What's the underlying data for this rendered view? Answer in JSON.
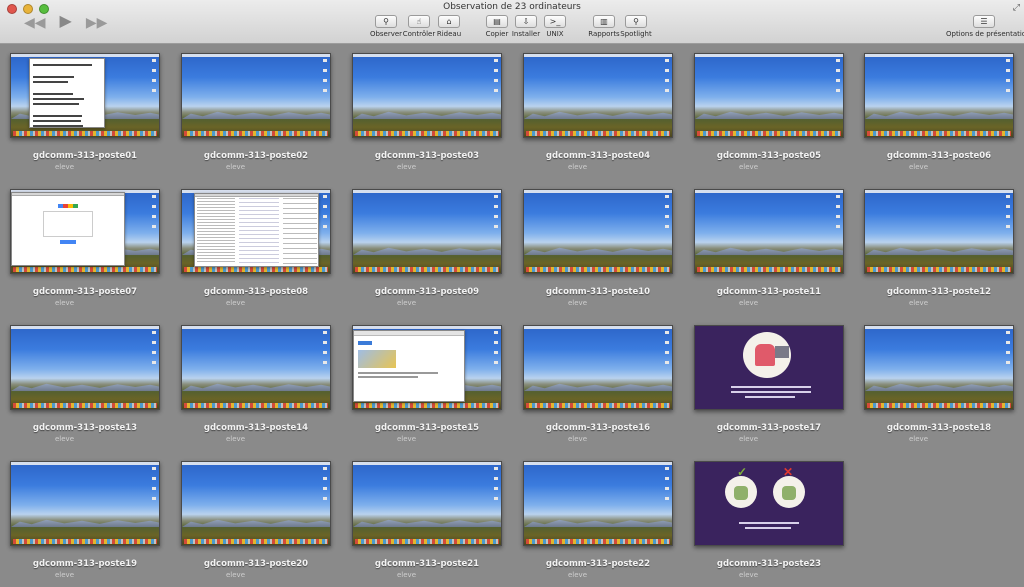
{
  "window": {
    "title": "Observation de 23 ordinateurs",
    "fullscreen_icon": "⤢"
  },
  "media": {
    "back": "◀◀",
    "play": "▶",
    "forward": "▶▶"
  },
  "toolbar": {
    "items": [
      {
        "id": "observer",
        "label": "Observer",
        "icon": "binoculars-icon",
        "glyph": "⚲"
      },
      {
        "id": "controler",
        "label": "Contrôler",
        "icon": "control-icon",
        "glyph": "☝"
      },
      {
        "id": "rideau",
        "label": "Rideau",
        "icon": "curtain-icon",
        "glyph": "⌂"
      },
      {
        "id": "copier",
        "label": "Copier",
        "icon": "copy-icon",
        "glyph": "▤"
      },
      {
        "id": "installer",
        "label": "Installer",
        "icon": "install-icon",
        "glyph": "⇩"
      },
      {
        "id": "unix",
        "label": "UNIX",
        "icon": "terminal-icon",
        "glyph": ">_"
      },
      {
        "id": "rapports",
        "label": "Rapports",
        "icon": "reports-icon",
        "glyph": "▥"
      },
      {
        "id": "spotlight",
        "label": "Spotlight",
        "icon": "spotlight-icon",
        "glyph": "⚲"
      }
    ],
    "presentation_options": {
      "label": "Options de présentation",
      "icon": "list-icon",
      "glyph": "☰"
    }
  },
  "computers": [
    {
      "name": "gdcomm-313-poste01",
      "user": "eleve",
      "screen": "text-window"
    },
    {
      "name": "gdcomm-313-poste02",
      "user": "eleve",
      "screen": "desktop"
    },
    {
      "name": "gdcomm-313-poste03",
      "user": "eleve",
      "screen": "desktop"
    },
    {
      "name": "gdcomm-313-poste04",
      "user": "eleve",
      "screen": "desktop"
    },
    {
      "name": "gdcomm-313-poste05",
      "user": "eleve",
      "screen": "desktop"
    },
    {
      "name": "gdcomm-313-poste06",
      "user": "eleve",
      "screen": "desktop"
    },
    {
      "name": "gdcomm-313-poste07",
      "user": "eleve",
      "screen": "google-window"
    },
    {
      "name": "gdcomm-313-poste08",
      "user": "eleve",
      "screen": "finder-window"
    },
    {
      "name": "gdcomm-313-poste09",
      "user": "eleve",
      "screen": "desktop"
    },
    {
      "name": "gdcomm-313-poste10",
      "user": "eleve",
      "screen": "desktop"
    },
    {
      "name": "gdcomm-313-poste11",
      "user": "eleve",
      "screen": "desktop"
    },
    {
      "name": "gdcomm-313-poste12",
      "user": "eleve",
      "screen": "desktop"
    },
    {
      "name": "gdcomm-313-poste13",
      "user": "eleve",
      "screen": "desktop"
    },
    {
      "name": "gdcomm-313-poste14",
      "user": "eleve",
      "screen": "desktop"
    },
    {
      "name": "gdcomm-313-poste15",
      "user": "eleve",
      "screen": "web-window"
    },
    {
      "name": "gdcomm-313-poste16",
      "user": "eleve",
      "screen": "desktop"
    },
    {
      "name": "gdcomm-313-poste17",
      "user": "eleve",
      "screen": "slide-person"
    },
    {
      "name": "gdcomm-313-poste18",
      "user": "eleve",
      "screen": "desktop"
    },
    {
      "name": "gdcomm-313-poste19",
      "user": "eleve",
      "screen": "desktop"
    },
    {
      "name": "gdcomm-313-poste20",
      "user": "eleve",
      "screen": "desktop"
    },
    {
      "name": "gdcomm-313-poste21",
      "user": "eleve",
      "screen": "desktop"
    },
    {
      "name": "gdcomm-313-poste22",
      "user": "eleve",
      "screen": "desktop"
    },
    {
      "name": "gdcomm-313-poste23",
      "user": "eleve",
      "screen": "slide-compare"
    }
  ]
}
